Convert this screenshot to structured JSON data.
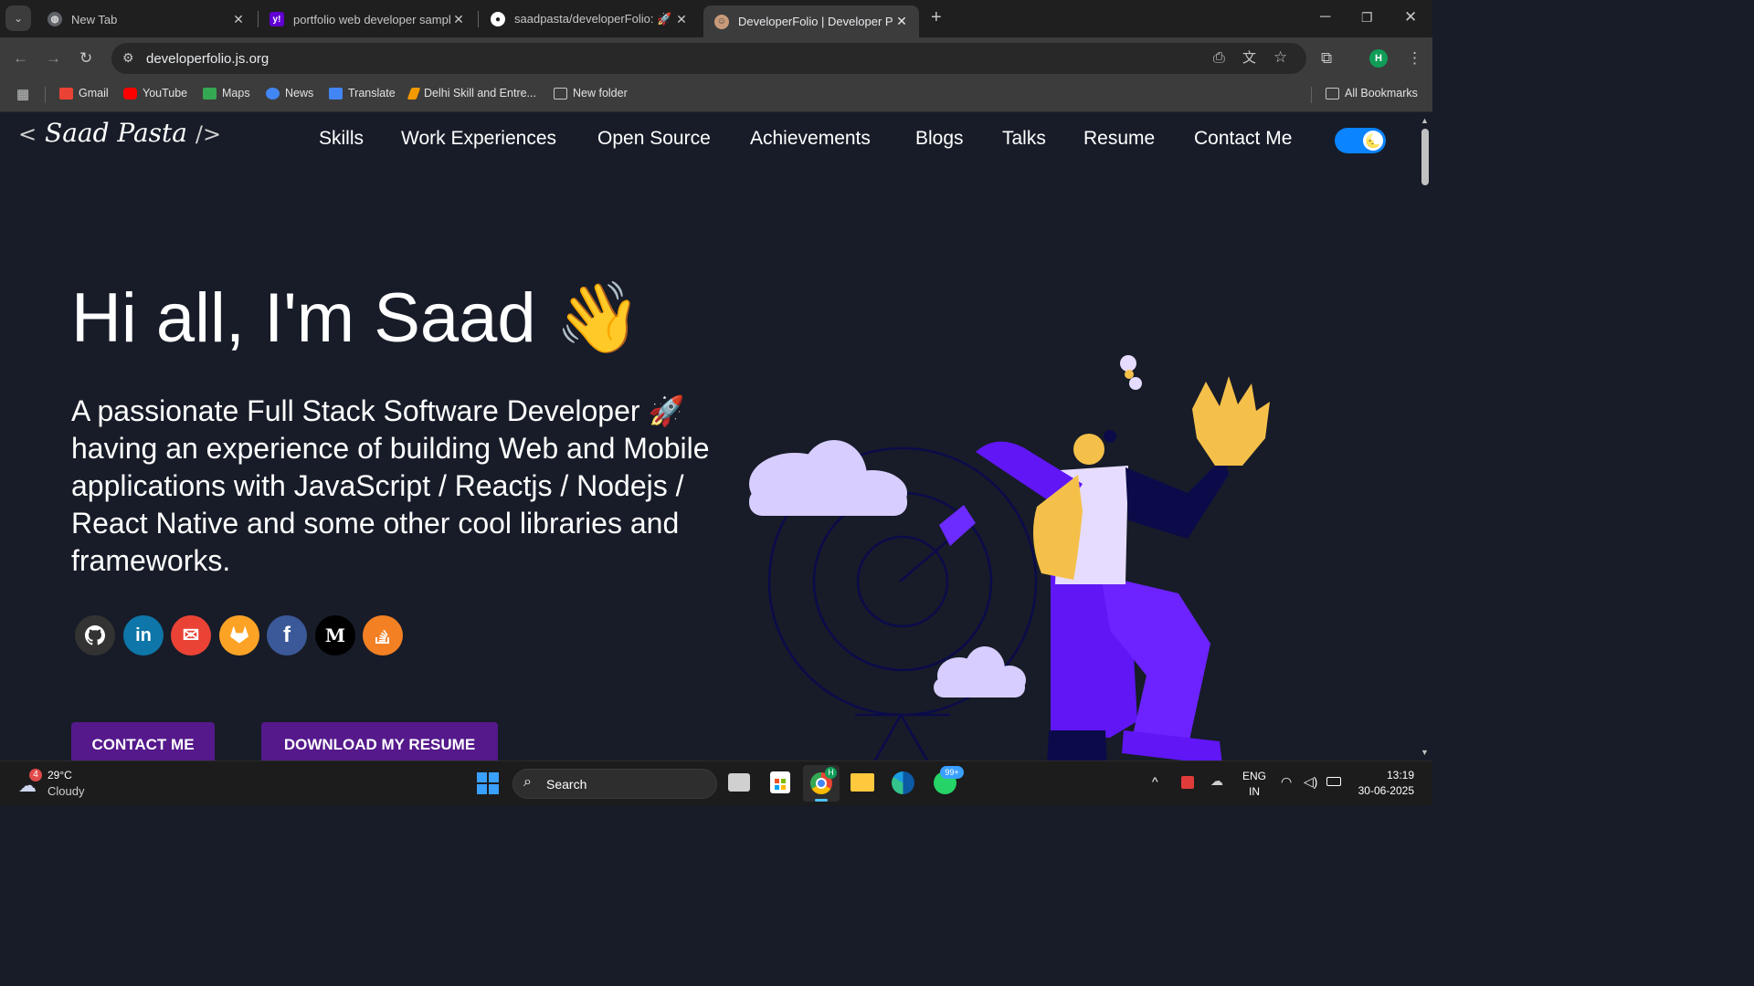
{
  "browser": {
    "tabs": [
      {
        "title": "New Tab"
      },
      {
        "title": "portfolio web developer sample"
      },
      {
        "title": "saadpasta/developerFolio: 🚀 S"
      },
      {
        "title": "DeveloperFolio | Developer Port"
      }
    ],
    "url": "developerfolio.js.org",
    "profile_initial": "H",
    "bookmarks": [
      {
        "label": "Gmail",
        "color": "#ea4335"
      },
      {
        "label": "YouTube",
        "color": "#ff0000"
      },
      {
        "label": "Maps",
        "color": "#34a853"
      },
      {
        "label": "News",
        "color": "#4285f4"
      },
      {
        "label": "Translate",
        "color": "#4285f4"
      },
      {
        "label": "Delhi Skill and Entre...",
        "color": "#f29900"
      },
      {
        "label": "New folder",
        "color": "#c4c7c5"
      }
    ],
    "all_bookmarks": "All Bookmarks"
  },
  "site": {
    "logo": {
      "open": "<",
      "name": "Saad Pasta",
      "close": "/>"
    },
    "nav": [
      "Skills",
      "Work Experiences",
      "Open Source",
      "Achievements",
      "Blogs",
      "Talks",
      "Resume",
      "Contact Me"
    ],
    "theme_toggle_on": true,
    "greeting": "Hi all, I'm Saad 👋",
    "description": "A passionate Full Stack Software Developer 🚀 having an experience of building Web and Mobile applications with JavaScript / Reactjs / Nodejs / React Native and some other cool libraries and frameworks.",
    "social": [
      {
        "name": "github",
        "glyph": "",
        "color": "#333333"
      },
      {
        "name": "linkedin",
        "glyph": "in",
        "color": "#0e76a8"
      },
      {
        "name": "gmail",
        "glyph": "✉",
        "color": "#ea4335"
      },
      {
        "name": "gitlab",
        "glyph": "",
        "color": "#fca326"
      },
      {
        "name": "facebook",
        "glyph": "f",
        "color": "#3b5998"
      },
      {
        "name": "medium",
        "glyph": "M",
        "color": "#000000"
      },
      {
        "name": "stack-overflow",
        "glyph": "",
        "color": "#f48024"
      }
    ],
    "buttons": {
      "contact": "CONTACT ME",
      "resume": "DOWNLOAD MY RESUME"
    }
  },
  "taskbar": {
    "weather": {
      "temp": "29°C",
      "condition": "Cloudy",
      "badge": "4"
    },
    "search_placeholder": "Search",
    "whatsapp_badge": "99+",
    "lang": {
      "line1": "ENG",
      "line2": "IN"
    },
    "time": "13:19",
    "date": "30-06-2025"
  }
}
